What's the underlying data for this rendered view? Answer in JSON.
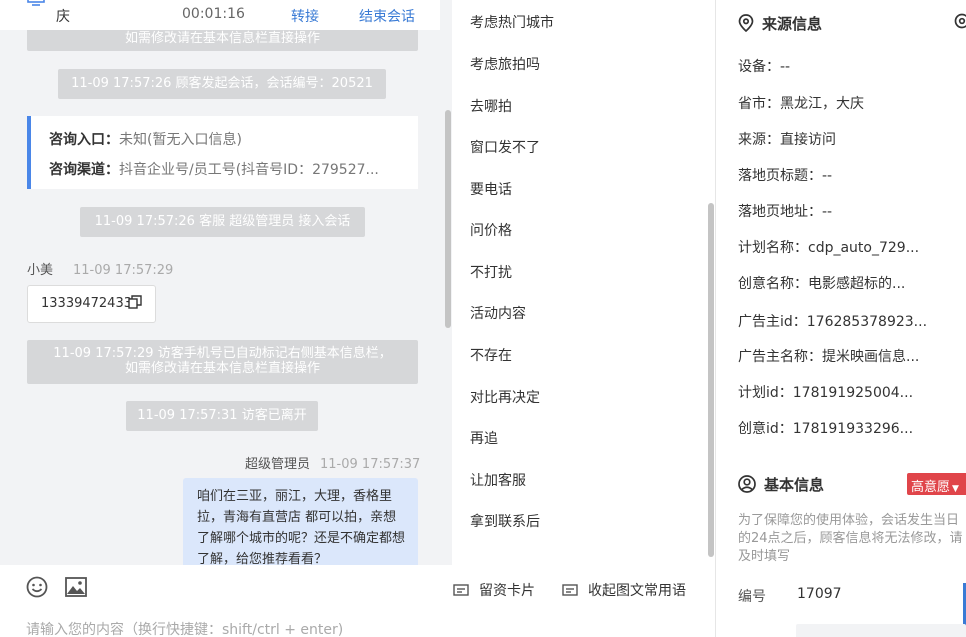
{
  "header": {
    "city": "庆",
    "duration": "00:01:16",
    "transfer_label": "转接",
    "end_label": "结束会话"
  },
  "chat": {
    "sys_top": "如需修改请在基本信息栏直接操作",
    "sys_start": "11-09 17:57:26 顾客发起会话，会话编号：20521",
    "inquiry_entry_label": "咨询入口：",
    "inquiry_entry_value": "未知(暂无入口信息)",
    "inquiry_channel_label": "咨询渠道：",
    "inquiry_channel_value": "抖音企业号/员工号(抖音号ID：279527...",
    "sys_accept": "11-09 17:57:26 客服 超级管理员 接入会话",
    "visitor_name": "小美",
    "visitor_time": "11-09 17:57:29",
    "visitor_phone": "13339472433",
    "sys_mark_line1": "11-09 17:57:29 访客手机号已自动标记右侧基本信息栏，",
    "sys_mark_line2": "如需修改请在基本信息栏直接操作",
    "sys_left": "11-09 17:57:31 访客已离开",
    "agent_name": "超级管理员",
    "agent_time": "11-09 17:57:37",
    "agent_message": "咱们在三亚，丽江，大理，香格里拉，青海有直营店 都可以拍，亲想了解哪个城市的呢？还是不确定都想了解，给您推荐看看？",
    "input_placeholder": "请输入您的内容（换行快捷键：shift/ctrl + enter)"
  },
  "quick_replies": [
    "考虑热门城市",
    "考虑旅拍吗",
    "去哪拍",
    "窗口发不了",
    "要电话",
    "问价格",
    "不打扰",
    "活动内容",
    "不存在",
    "对比再决定",
    "再追",
    "让加客服",
    "拿到联系后"
  ],
  "tools": {
    "card_label": "留资卡片",
    "phrases_label": "收起图文常用语"
  },
  "source": {
    "title": "来源信息",
    "device": "设备：--",
    "province": "省市：黑龙江，大庆",
    "origin": "来源：直接访问",
    "landing_title": "落地页标题：--",
    "landing_url": "落地页地址：--",
    "plan_name": "计划名称：cdp_auto_729...",
    "creative_name": "创意名称：电影感超标的...",
    "advertiser_id": "广告主id：176285378923...",
    "advertiser_name": "广告主名称：提米映画信息...",
    "plan_id": "计划id：178191925004...",
    "creative_id": "创意id：178191933296..."
  },
  "basic": {
    "title": "基本信息",
    "intent_badge": "高意愿",
    "notice": "为了保障您的使用体验，会话发生当日的24点之后，顾客信息将无法修改，请及时填写",
    "number_label": "编号",
    "number_value": "17097"
  }
}
